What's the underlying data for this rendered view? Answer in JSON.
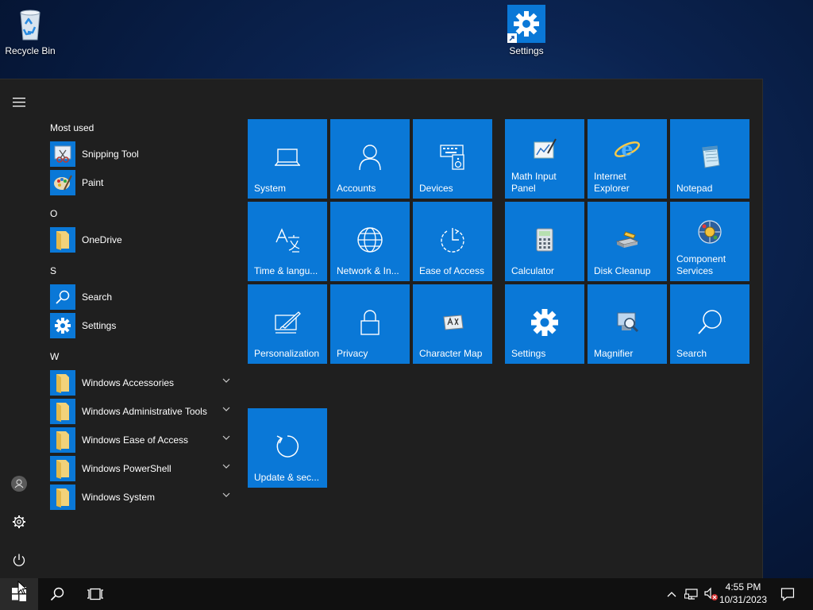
{
  "desktop": {
    "icons": [
      {
        "label": "Recycle Bin",
        "icon": "recycle-bin-icon"
      },
      {
        "label": "Settings",
        "icon": "gear-icon"
      }
    ]
  },
  "start_menu": {
    "rail": {
      "menu": "hamburger-icon",
      "account": "user-icon",
      "settings": "gear-icon",
      "power": "power-icon"
    },
    "app_list": {
      "most_used_header": "Most used",
      "most_used": [
        {
          "label": "Snipping Tool",
          "icon": "snipping-tool-icon"
        },
        {
          "label": "Paint",
          "icon": "paint-icon"
        }
      ],
      "group_o": "O",
      "o_items": [
        {
          "label": "OneDrive",
          "icon": "onedrive-icon"
        }
      ],
      "group_s": "S",
      "s_items": [
        {
          "label": "Search",
          "icon": "search-icon"
        },
        {
          "label": "Settings",
          "icon": "gear-icon"
        }
      ],
      "group_w": "W",
      "w_items": [
        {
          "label": "Windows Accessories",
          "icon": "folder-icon"
        },
        {
          "label": "Windows Administrative Tools",
          "icon": "folder-icon"
        },
        {
          "label": "Windows Ease of Access",
          "icon": "folder-icon"
        },
        {
          "label": "Windows PowerShell",
          "icon": "folder-icon"
        },
        {
          "label": "Windows System",
          "icon": "folder-icon"
        }
      ]
    },
    "tiles": {
      "group1": [
        {
          "label": "System",
          "icon": "laptop-icon"
        },
        {
          "label": "Accounts",
          "icon": "person-icon"
        },
        {
          "label": "Devices",
          "icon": "devices-icon"
        },
        {
          "label": "Time & langu...",
          "icon": "time-language-icon"
        },
        {
          "label": "Network & In...",
          "icon": "globe-icon"
        },
        {
          "label": "Ease of Access",
          "icon": "ease-of-access-icon"
        },
        {
          "label": "Personalization",
          "icon": "personalization-icon"
        },
        {
          "label": "Privacy",
          "icon": "lock-icon"
        },
        {
          "label": "Character Map",
          "icon": "character-map-icon"
        }
      ],
      "group2": [
        {
          "label": "Math Input Panel",
          "icon": "math-input-icon"
        },
        {
          "label": "Internet Explorer",
          "icon": "internet-explorer-icon"
        },
        {
          "label": "Notepad",
          "icon": "notepad-icon"
        },
        {
          "label": "Calculator",
          "icon": "calculator-icon"
        },
        {
          "label": "Disk Cleanup",
          "icon": "disk-cleanup-icon"
        },
        {
          "label": "Component Services",
          "icon": "component-services-icon"
        },
        {
          "label": "Settings",
          "icon": "gear-icon"
        },
        {
          "label": "Magnifier",
          "icon": "magnifier-icon"
        },
        {
          "label": "Search",
          "icon": "search-icon"
        }
      ],
      "group3": [
        {
          "label": "Update & sec...",
          "icon": "update-icon"
        }
      ]
    }
  },
  "taskbar": {
    "start": "windows-logo-icon",
    "search": "search-icon",
    "task_view": "task-view-icon",
    "tray": {
      "chevron": "chevron-up-icon",
      "network": "network-icon",
      "volume": "volume-muted-icon"
    },
    "time": "4:55 PM",
    "date": "10/31/2023",
    "notifications": "action-center-icon"
  }
}
